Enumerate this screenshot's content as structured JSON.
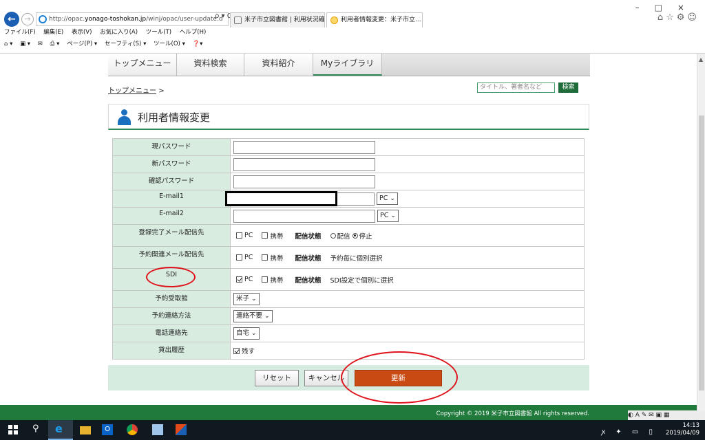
{
  "browser": {
    "url_prefix": "http://opac.",
    "url_domain": "yonago-toshokan.jp",
    "url_path": "/winj/opac/user-update.d",
    "addr_tools": "ρ ▾ C",
    "tabs": [
      {
        "label": "米子市立図書館 | 利用状況確認"
      },
      {
        "label": "利用者情報変更：米子市立...",
        "close": "×"
      }
    ],
    "window_controls": "–□×",
    "right_icons": "⌂☆⚙☺",
    "menu": [
      "ファイル(F)",
      "編集(E)",
      "表示(V)",
      "お気に入り(A)",
      "ツール(T)",
      "ヘルプ(H)"
    ],
    "commands": [
      "ページ(P) ▾",
      "セーフティ(S) ▾",
      "ツール(O) ▾"
    ]
  },
  "nav": {
    "items": [
      "トップメニュー",
      "資料検索",
      "資料紹介",
      "Myライブラリ"
    ]
  },
  "breadcrumb": {
    "link": "トップメニュー",
    "sep": ">"
  },
  "search": {
    "placeholder": "タイトル、著者名など",
    "button": "検索"
  },
  "panel": {
    "title": "利用者情報変更"
  },
  "form": {
    "current_password": "現パスワード",
    "new_password": "新パスワード",
    "confirm_password": "確認パスワード",
    "email1": "E-mail1",
    "email2": "E-mail2",
    "email_type_1": "PC",
    "email_type_2": "PC",
    "reg_mail_label": "登録完了メール配信先",
    "reserve_mail_label": "予約関連メール配信先",
    "sdi_label": "SDI",
    "opt_pc": "PC",
    "opt_mobile": "携帯",
    "status_label": "配信状態",
    "radio_deliver": "配信",
    "radio_stop": "停止",
    "reserve_note": "予約毎に個別選択",
    "sdi_note": "SDI設定で個別に選択",
    "pickup_label": "予約受取館",
    "pickup_value": "米子",
    "contact_method_label": "予約連絡方法",
    "contact_method_value": "連絡不要",
    "phone_label": "電話連絡先",
    "phone_value": "自宅",
    "history_label": "貸出履歴",
    "history_value": "残す"
  },
  "buttons": {
    "reset": "リセット",
    "cancel": "キャンセル",
    "update": "更新"
  },
  "footer": {
    "copyright": "Copyright © 2019 米子市立図書館 All rights reserved."
  },
  "taskbar": {
    "time": "14:13",
    "date": "2019/04/09",
    "search_icon": "⚲",
    "ie_glyph": "e",
    "outlook_glyph": "O",
    "tray": "ꭗ ✦ ▭ ▯"
  },
  "strip": {
    "icons": "◐ A ✎ ✉ ▣ ▦"
  },
  "colors": {
    "brand_green": "#1f7a3c",
    "update_button": "#c94a12",
    "annotation": "#e0121b"
  }
}
